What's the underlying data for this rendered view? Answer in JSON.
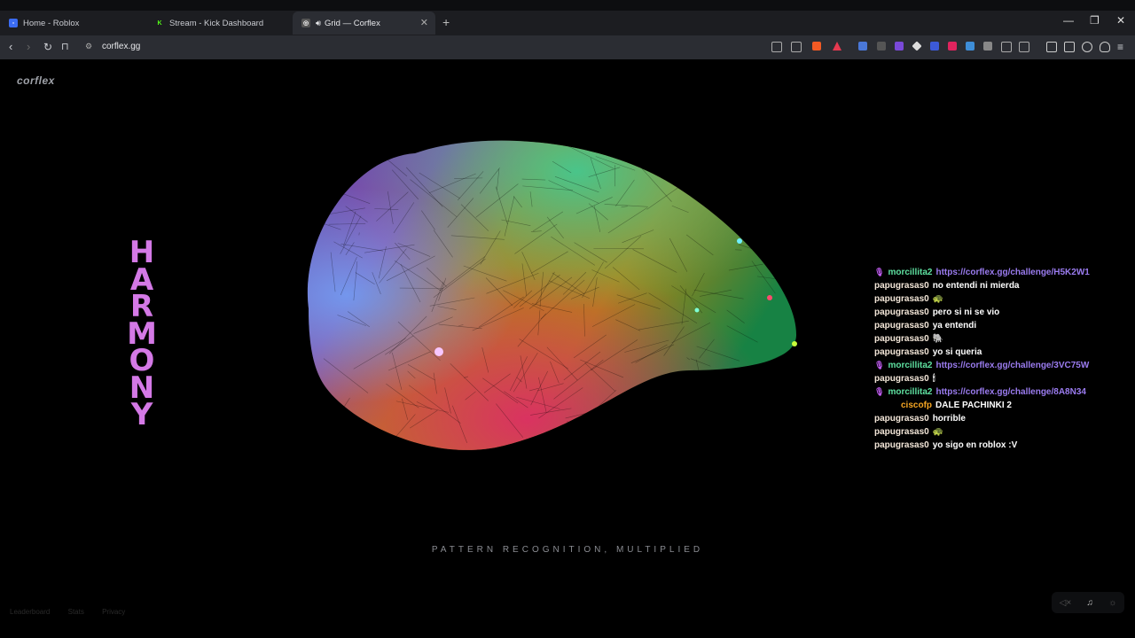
{
  "browser": {
    "tabs": [
      {
        "title": "Home - Roblox",
        "favicon_color": "#3b6cf2"
      },
      {
        "title": "Stream - Kick Dashboard",
        "favicon_color": "#53fc18"
      },
      {
        "title": "Grid — Corflex",
        "favicon_color": "#555555"
      }
    ],
    "address": "corflex.gg"
  },
  "site": {
    "brand": "corflex",
    "harmony_letters": "HARMONY",
    "tagline": "PATTERN RECOGNITION, MULTIPLIED",
    "footer_links": [
      "Leaderboard",
      "Stats",
      "Privacy"
    ]
  },
  "chat": [
    {
      "user": "morcillita2",
      "user_color": "#5ee0a0",
      "badge": true,
      "text": "https://corflex.gg/challenge/H5K2W1",
      "is_link": true
    },
    {
      "user": "papugrasas0",
      "user_color": "#f3e6d8",
      "text": "no entendi ni mierda"
    },
    {
      "user": "papugrasas0",
      "user_color": "#f3e6d8",
      "text": "🐢"
    },
    {
      "user": "papugrasas0",
      "user_color": "#f3e6d8",
      "text": "pero si ni se vio"
    },
    {
      "user": "papugrasas0",
      "user_color": "#f3e6d8",
      "text": "ya entendi"
    },
    {
      "user": "papugrasas0",
      "user_color": "#f3e6d8",
      "text": "🐘"
    },
    {
      "user": "papugrasas0",
      "user_color": "#f3e6d8",
      "text": "yo si queria"
    },
    {
      "user": "morcillita2",
      "user_color": "#5ee0a0",
      "badge": true,
      "text": "https://corflex.gg/challenge/3VC75W",
      "is_link": true
    },
    {
      "user": "papugrasas0",
      "user_color": "#f3e6d8",
      "text": "🕯"
    },
    {
      "user": "morcillita2",
      "user_color": "#5ee0a0",
      "badge": true,
      "text": "https://corflex.gg/challenge/8A8N34",
      "is_link": true
    },
    {
      "user": "ciscofp",
      "user_color": "#f5a623",
      "indent": true,
      "text": "DALE PACHINKI 2"
    },
    {
      "user": "papugrasas0",
      "user_color": "#f3e6d8",
      "text": "horrible"
    },
    {
      "user": "papugrasas0",
      "user_color": "#f3e6d8",
      "text": "🐢"
    },
    {
      "user": "papugrasas0",
      "user_color": "#f3e6d8",
      "text": "yo sigo en roblox :V"
    }
  ]
}
